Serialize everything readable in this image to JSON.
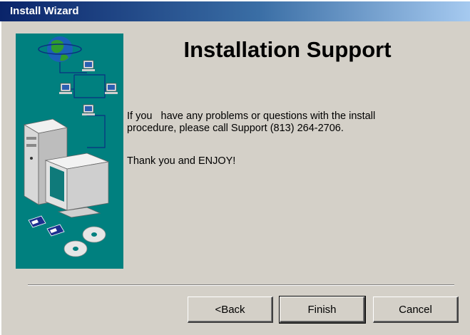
{
  "window": {
    "title": "Install Wizard"
  },
  "main": {
    "heading": "Installation Support",
    "paragraph1_line1": "If you   have any problems or questions with the install",
    "paragraph1_line2": "procedure, please call Support (813) 264-2706.",
    "paragraph2": "Thank you and ENJOY!"
  },
  "buttons": {
    "back_label": "<Back",
    "finish_label": "Finish",
    "cancel_label": "Cancel"
  },
  "icons": {
    "side_illustration": "computer-network-illustration",
    "globe": "globe-icon",
    "network_pc": "network-computer-icon",
    "desktop": "desktop-computer-icon",
    "floppy": "floppy-disk-icon",
    "cd": "cd-disc-icon"
  },
  "colors": {
    "titlebar_start": "#0a246a",
    "titlebar_end": "#a6caf0",
    "dialog_bg": "#d4d0c8",
    "panel_bg": "#00807f"
  }
}
